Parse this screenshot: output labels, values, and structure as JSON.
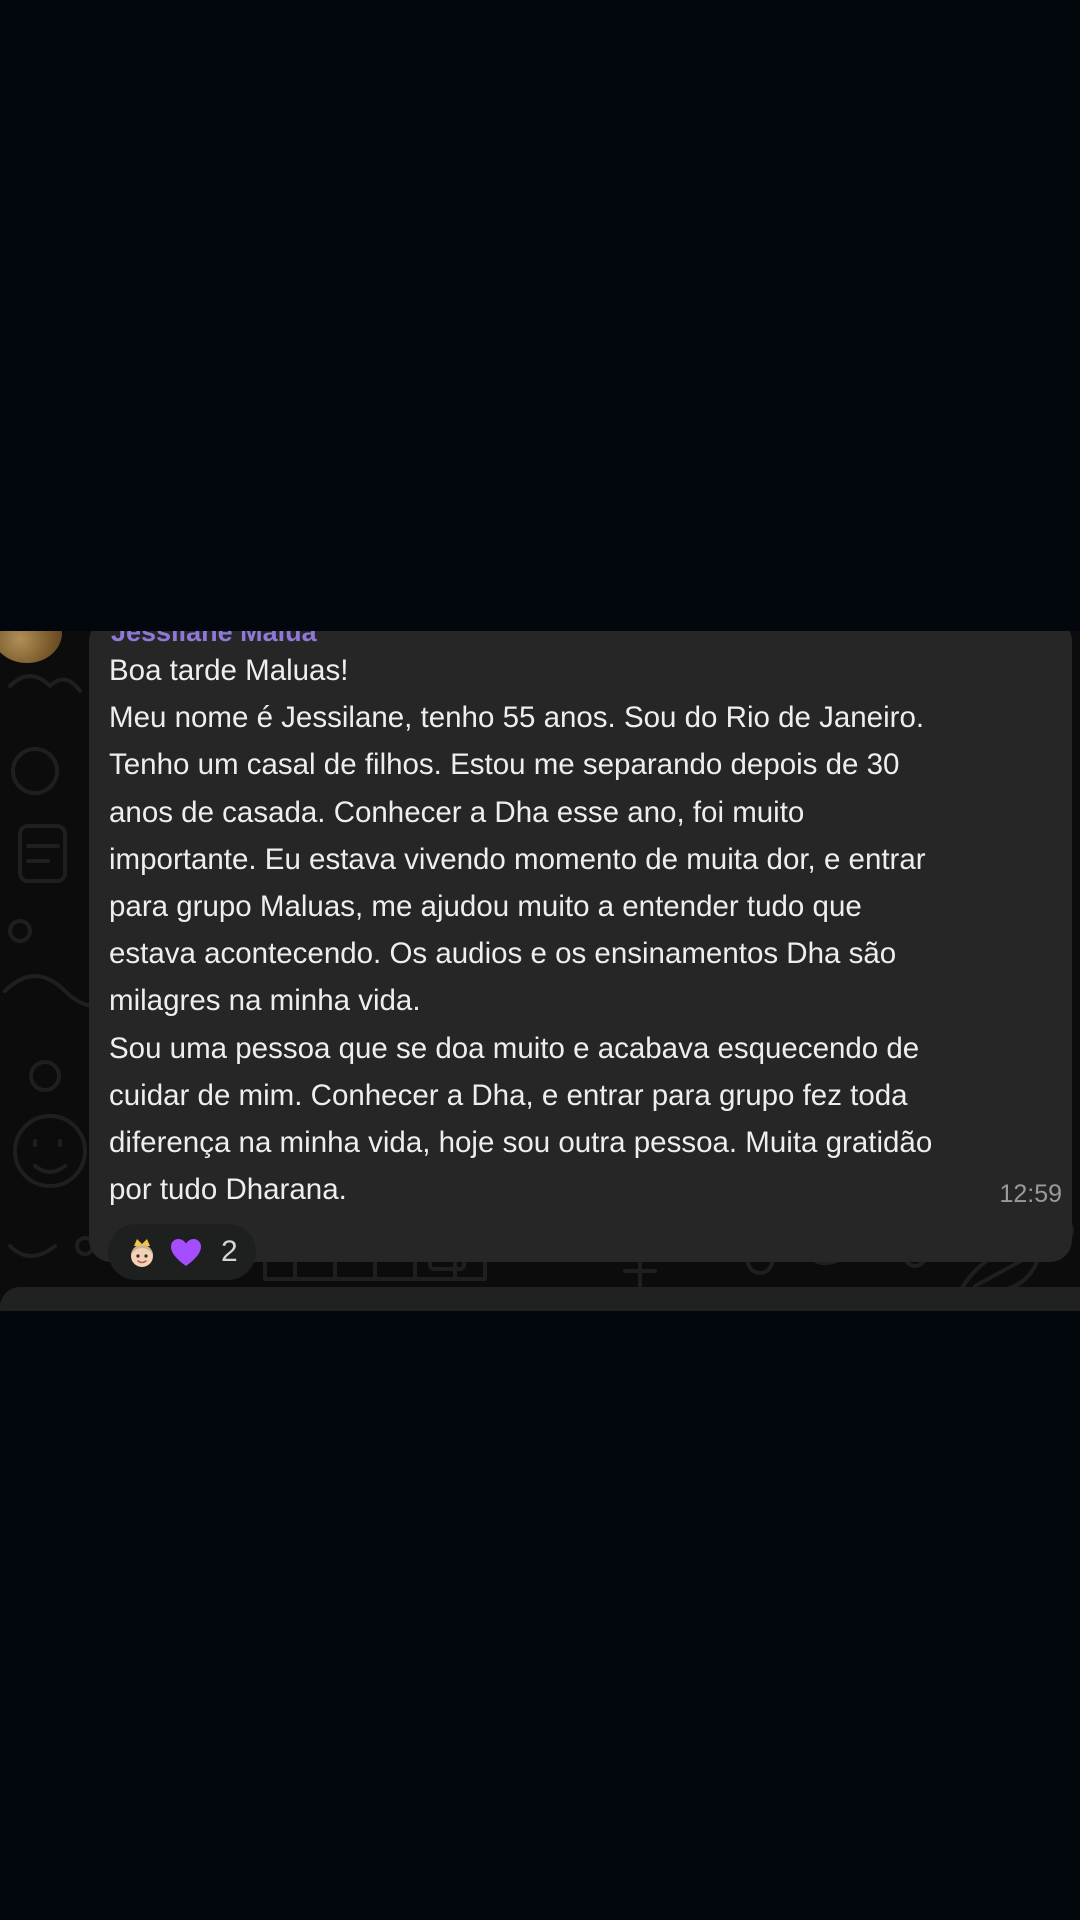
{
  "message": {
    "sender_name": "Jessilane Malua",
    "lines": [
      "Boa tarde Maluas!",
      "Meu nome é Jessilane, tenho 55 anos. Sou do Rio de Janeiro.",
      "Tenho um casal de filhos. Estou me separando depois de 30",
      "anos de casada. Conhecer a Dha esse ano, foi muito",
      "importante. Eu estava vivendo momento de muita dor, e entrar",
      "para grupo Maluas, me ajudou muito a entender tudo que",
      "estava acontecendo. Os audios e os ensinamentos Dha são",
      "milagres na minha vida.",
      "Sou uma pessoa que se doa muito e acabava esquecendo de",
      "cuidar de mim. Conhecer a Dha, e entrar para grupo fez toda",
      "diferença na minha vida, hoje sou outra pessoa. Muita gratidão",
      "por tudo Dharana."
    ],
    "time": "12:59"
  },
  "reactions": {
    "emojis": [
      "princess-emoji-icon",
      "purple-heart-icon"
    ],
    "count": "2"
  },
  "colors": {
    "background": "#02060d",
    "chat_background": "#0c0c0c",
    "bubble": "#252625",
    "sender_name": "#8f79d8",
    "text": "#eeeeee",
    "timestamp": "#9a9a9a",
    "heart": "#a64dff"
  }
}
